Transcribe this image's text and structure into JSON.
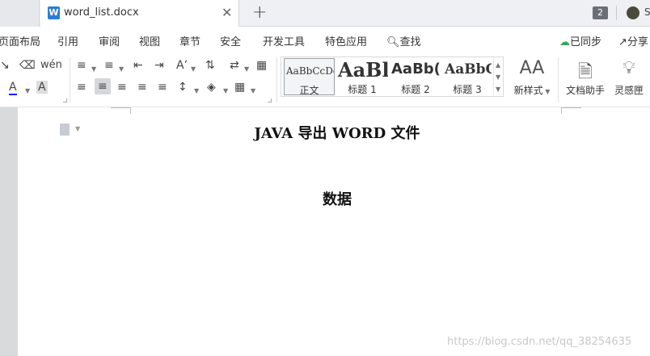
{
  "tabbar": {
    "doc_tab_title": "word_list.docx",
    "doc_icon_letter": "W",
    "close_glyph": "✕",
    "new_tab_glyph": "+",
    "window_count": "2",
    "user_initial": "S"
  },
  "menu": {
    "items": [
      "页面布局",
      "引用",
      "审阅",
      "视图",
      "章节",
      "安全",
      "开发工具",
      "特色应用",
      "查找"
    ],
    "sync_label": "已同步",
    "share_label": "分享"
  },
  "ribbon": {
    "styles": [
      {
        "sample": "AaBbCcDd",
        "name": "正文"
      },
      {
        "sample": "AaBl",
        "name": "标题 1"
      },
      {
        "sample": "AaBb(",
        "name": "标题 2"
      },
      {
        "sample": "AaBbC",
        "name": "标题 3"
      }
    ],
    "new_style_label": "新样式",
    "doc_assistant_label": "文档助手",
    "inspiration_label": "灵感匣",
    "font_color": "#1a1aff",
    "highlight_letter": "A",
    "font_color_letter": "A"
  },
  "document": {
    "title": "JAVA 导出 WORD 文件",
    "heading": "数据"
  },
  "watermark": "https://blog.csdn.net/qq_38254635"
}
